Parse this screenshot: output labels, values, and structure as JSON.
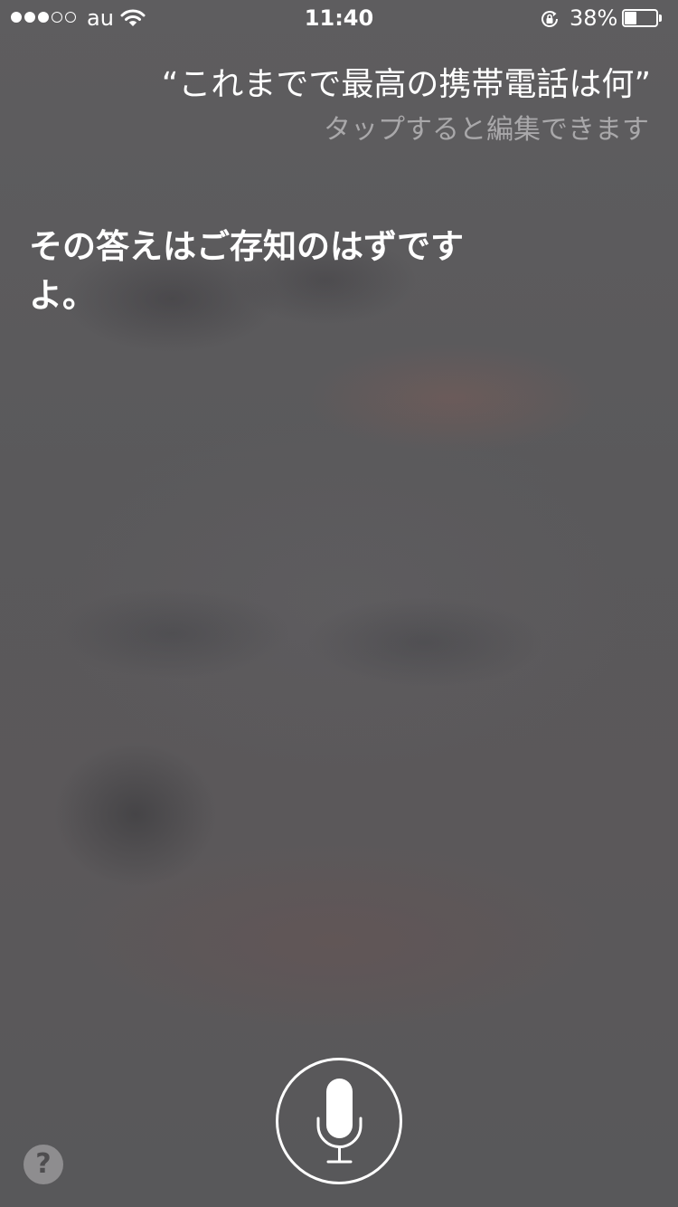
{
  "status_bar": {
    "signal_strength": {
      "filled": 3,
      "total": 5
    },
    "carrier": "au",
    "time": "11:40",
    "battery_percent_label": "38%",
    "battery_level": 0.38,
    "icons": [
      "wifi-icon",
      "rotation-lock-icon",
      "battery-icon"
    ]
  },
  "siri": {
    "query": "“これまでで最高の携帯電話は何”",
    "tap_to_edit": "タップすると編集できます",
    "answer": "その答えはご存知のはずですよ。"
  },
  "controls": {
    "mic_icon": "microphone-icon",
    "help_label": "?"
  },
  "colors": {
    "text_primary": "#ffffff",
    "text_secondary": "#a9a8aa",
    "help_bg": "#8e8d8f"
  }
}
